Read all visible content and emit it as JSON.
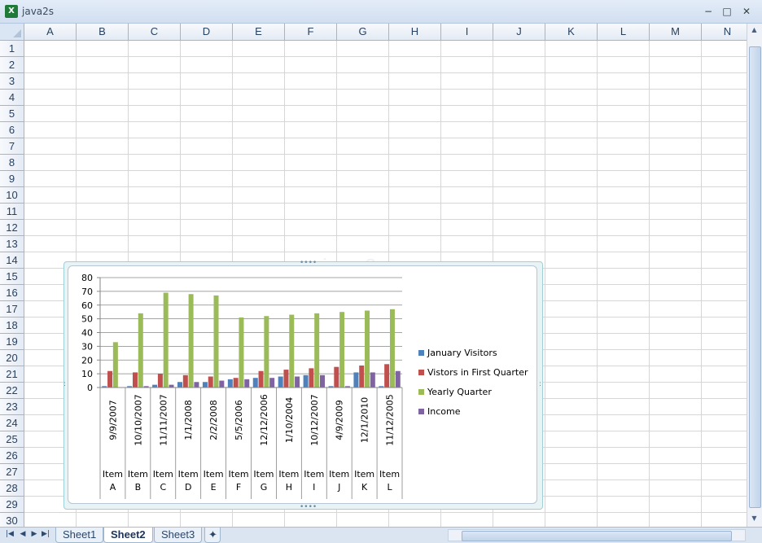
{
  "window": {
    "title": "java2s",
    "app_icon": "excel-icon",
    "minimize": "−",
    "restore": "□",
    "close": "✕"
  },
  "columns": [
    "A",
    "B",
    "C",
    "D",
    "E",
    "F",
    "G",
    "H",
    "I",
    "J",
    "K",
    "L",
    "M",
    "N"
  ],
  "rows": [
    "1",
    "2",
    "3",
    "4",
    "5",
    "6",
    "7",
    "8",
    "9",
    "10",
    "11",
    "12",
    "13",
    "14",
    "15",
    "16",
    "17",
    "18",
    "19",
    "20",
    "21",
    "22",
    "23",
    "24",
    "25",
    "26",
    "27",
    "28",
    "29",
    "30"
  ],
  "watermark": "www.java2s.com",
  "sheets": {
    "tabs": [
      "Sheet1",
      "Sheet2",
      "Sheet3"
    ],
    "active": "Sheet2"
  },
  "colors": {
    "January Visitors": "#4f81bd",
    "Vistors in First Quarter": "#c0504d",
    "Yearly Quarter": "#9bbb59",
    "Income": "#8064a2"
  },
  "chart_data": {
    "type": "bar",
    "categories": [
      {
        "date": "9/9/2007",
        "item": "Item",
        "letter": "A"
      },
      {
        "date": "10/10/2007",
        "item": "Item",
        "letter": "B"
      },
      {
        "date": "11/11/2007",
        "item": "Item",
        "letter": "C"
      },
      {
        "date": "1/1/2008",
        "item": "Item",
        "letter": "D"
      },
      {
        "date": "2/2/2008",
        "item": "Item",
        "letter": "E"
      },
      {
        "date": "5/5/2006",
        "item": "Item",
        "letter": "F"
      },
      {
        "date": "12/12/2006",
        "item": "Item",
        "letter": "G"
      },
      {
        "date": "1/10/2004",
        "item": "Item",
        "letter": "H"
      },
      {
        "date": "10/12/2007",
        "item": "Item",
        "letter": "I"
      },
      {
        "date": "4/9/2009",
        "item": "Item",
        "letter": "J"
      },
      {
        "date": "12/1/2010",
        "item": "Item",
        "letter": "K"
      },
      {
        "date": "11/12/2005",
        "item": "Item",
        "letter": "L"
      }
    ],
    "series": [
      {
        "name": "January Visitors",
        "values": [
          1,
          1,
          2,
          4,
          4,
          6,
          7,
          8,
          9,
          1,
          11,
          1
        ]
      },
      {
        "name": "Vistors in First Quarter",
        "values": [
          12,
          11,
          10,
          9,
          8,
          7,
          12,
          13,
          14,
          15,
          16,
          17
        ]
      },
      {
        "name": "Yearly Quarter",
        "values": [
          33,
          54,
          69,
          68,
          67,
          51,
          52,
          53,
          54,
          55,
          56,
          57
        ]
      },
      {
        "name": "Income",
        "values": [
          0,
          1,
          2,
          4,
          5,
          6,
          7,
          8,
          9,
          1,
          11,
          12
        ]
      }
    ],
    "yticks": [
      0,
      10,
      20,
      30,
      40,
      50,
      60,
      70,
      80
    ],
    "ylim": [
      0,
      80
    ],
    "grid": true,
    "legend": "right"
  }
}
